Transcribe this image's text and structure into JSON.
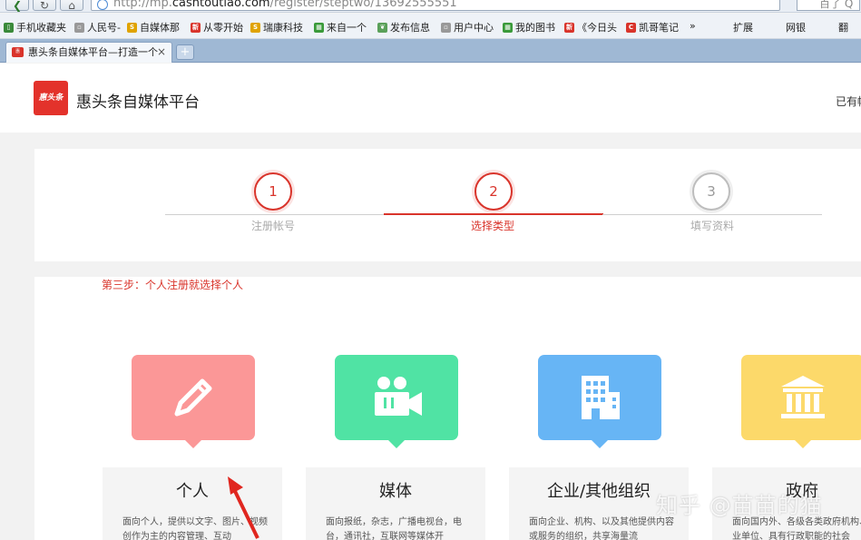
{
  "browser": {
    "address_prefix": "http://mp.",
    "address_domain": "cashtoutiao.com",
    "address_path": "/register/steptwo/13692555551",
    "search_placeholder": "百了 Q",
    "bookmarks": [
      {
        "label": "手机收藏夹",
        "icon": "phone-icon",
        "color": "#3a8a3a"
      },
      {
        "label": "人民号-",
        "icon": "page-icon",
        "color": "#999999"
      },
      {
        "label": "自媒体那",
        "icon": "s-icon",
        "color": "#e0a300"
      },
      {
        "label": "从零开始",
        "icon": "news-icon",
        "color": "#d9342b"
      },
      {
        "label": "瑞康科技",
        "icon": "s-icon",
        "color": "#e0a300"
      },
      {
        "label": "来自一个",
        "icon": "grid-icon",
        "color": "#3a9a3a"
      },
      {
        "label": "发布信息",
        "icon": "leaf-icon",
        "color": "#5aa05a"
      },
      {
        "label": "用户中心",
        "icon": "page-icon",
        "color": "#999999"
      },
      {
        "label": "我的图书",
        "icon": "grid-icon",
        "color": "#3a9a3a"
      },
      {
        "label": "《今日头",
        "icon": "news-icon",
        "color": "#d9342b"
      },
      {
        "label": "凯哥笔记",
        "icon": "c-icon",
        "color": "#d9342b"
      }
    ],
    "more": "»",
    "extensions": "扩展",
    "netbank": "网银",
    "translate": "翻",
    "tab_title": "惠头条自媒体平台—打造一个",
    "tab_close": "×",
    "new_tab": "+"
  },
  "header": {
    "logo_text": "惠头条",
    "site_title": "惠头条自媒体平台",
    "login_text": "已有帐"
  },
  "steps": [
    {
      "number": "1",
      "label": "注册帐号",
      "state": "done"
    },
    {
      "number": "2",
      "label": "选择类型",
      "state": "active"
    },
    {
      "number": "3",
      "label": "填写资料",
      "state": "pending"
    }
  ],
  "hint": "第三步：个人注册就选择个人",
  "types": [
    {
      "name": "个人",
      "desc": "面向个人，提供以文字、图片、视频创作为主的内容管理、互动",
      "color": "#fb9797",
      "icon": "pencil-icon"
    },
    {
      "name": "媒体",
      "desc": "面向报纸，杂志，广播电视台，电台，通讯社，互联网等媒体开",
      "color": "#50e3a4",
      "icon": "video-camera-icon"
    },
    {
      "name": "企业/其他组织",
      "desc": "面向企业、机构、以及其他提供内容或服务的组织，共享海量流",
      "color": "#67b5f5",
      "icon": "building-icon"
    },
    {
      "name": "政府",
      "desc": "面向国内外、各级各类政府机构、事业单位、具有行政职能的社会",
      "color": "#fcd96a",
      "icon": "government-icon"
    }
  ],
  "watermark": "知乎 @苗苗的猫"
}
